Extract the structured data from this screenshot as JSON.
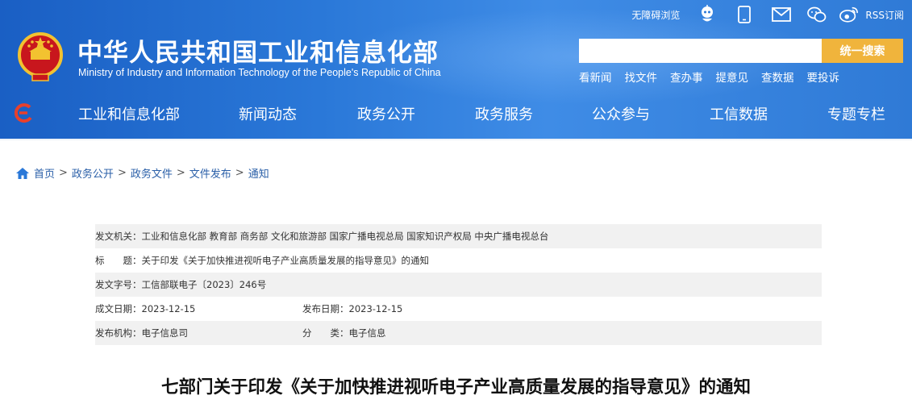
{
  "colors": {
    "header_bg": "#2a78d8",
    "search_button": "#f0b43c",
    "link": "#2a5fa8",
    "meta_row_bg": "#f1f1f1"
  },
  "header": {
    "title_cn": "中华人民共和国工业和信息化部",
    "title_en": "Ministry of Industry and Information Technology of the People's Republic of China",
    "emblem_icon": "national-emblem-icon",
    "top_links": {
      "accessibility": "无障碍浏览",
      "rss": "RSS订阅"
    },
    "top_icons": [
      "robot-assistant-icon",
      "mobile-icon",
      "mail-icon",
      "wechat-icon",
      "weibo-icon"
    ],
    "search": {
      "placeholder": "",
      "button": "统一搜索"
    },
    "quick_links": [
      "看新闻",
      "找文件",
      "查办事",
      "提意见",
      "查数据",
      "要投诉"
    ]
  },
  "nav": {
    "logo_icon": "ministry-logo-icon",
    "items": [
      "工业和信息化部",
      "新闻动态",
      "政务公开",
      "政务服务",
      "公众参与",
      "工信数据",
      "专题专栏"
    ]
  },
  "breadcrumb": {
    "icon": "home-icon",
    "items": [
      "首页",
      "政务公开",
      "政务文件",
      "文件发布",
      "通知"
    ],
    "separator": ">"
  },
  "meta": {
    "issuer_label": "发文机关：",
    "issuer_value": "工业和信息化部 教育部 商务部 文化和旅游部 国家广播电视总局 国家知识产权局 中央广播电视总台",
    "title_label": "标　　题：",
    "title_value": "关于印发《关于加快推进视听电子产业高质量发展的指导意见》的通知",
    "docno_label": "发文字号：",
    "docno_value": "工信部联电子〔2023〕246号",
    "written_label": "成文日期：",
    "written_value": "2023-12-15",
    "published_label": "发布日期：",
    "published_value": "2023-12-15",
    "org_label": "发布机构：",
    "org_value": "电子信息司",
    "category_label": "分　　类：",
    "category_value": "电子信息"
  },
  "document_title": "七部门关于印发《关于加快推进视听电子产业高质量发展的指导意见》的通知"
}
